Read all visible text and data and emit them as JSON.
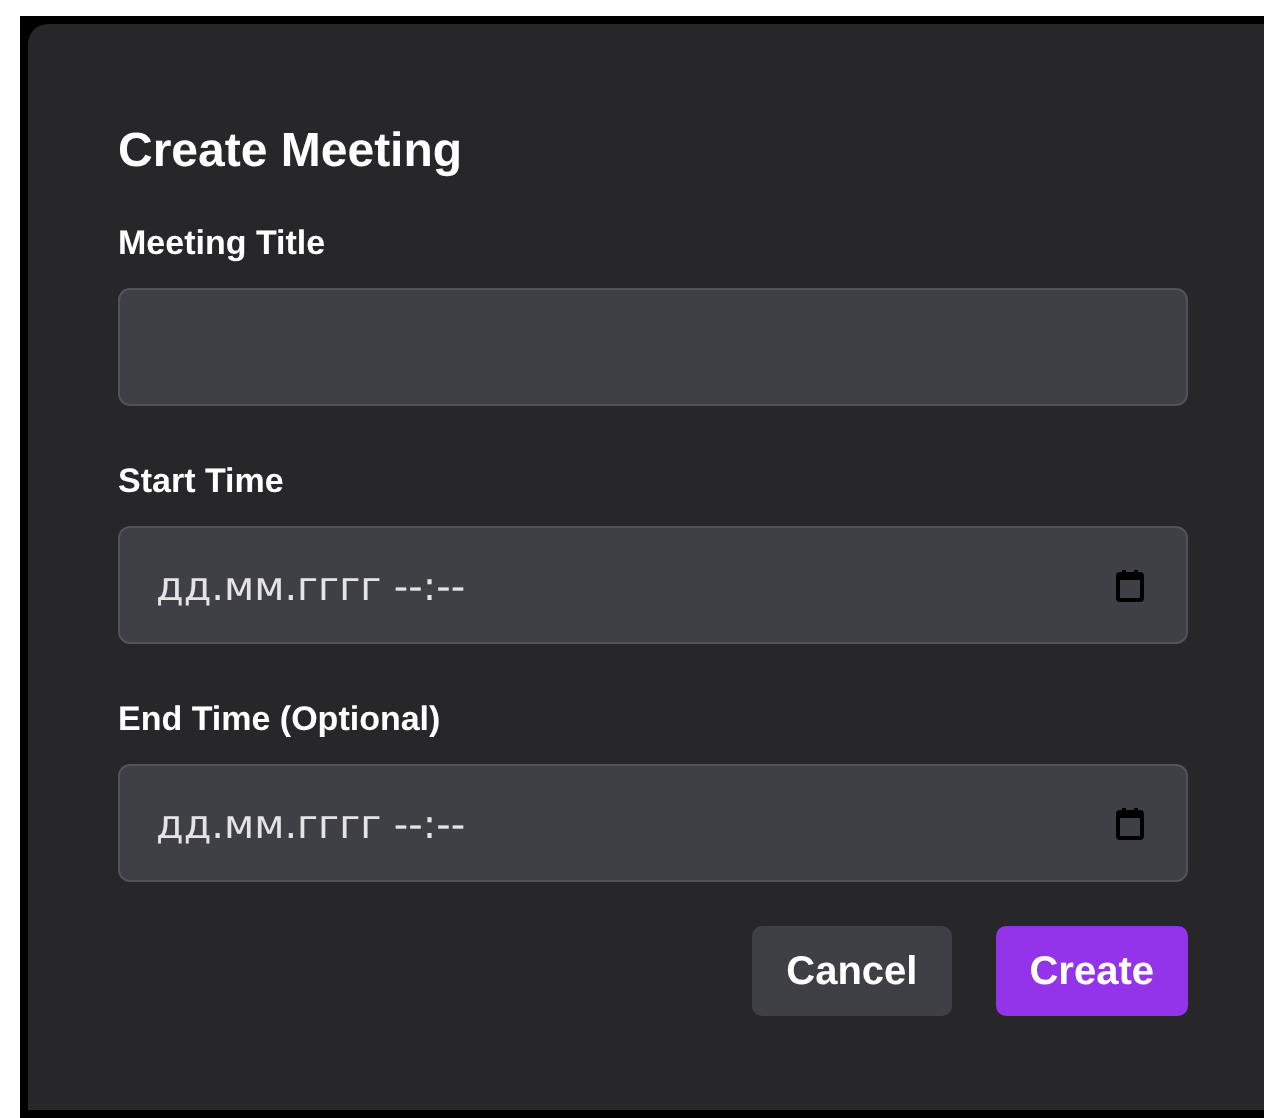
{
  "dialog": {
    "title": "Create Meeting",
    "fields": [
      {
        "kind": "text",
        "label": "Meeting Title"
      },
      {
        "kind": "datetime",
        "label": "Start Time",
        "placeholder": "дд.мм.гггг --:--"
      },
      {
        "kind": "datetime",
        "label": "End Time (Optional)",
        "placeholder": "дд.мм.гггг --:--"
      }
    ],
    "buttons": [
      {
        "kind": "secondary",
        "label": "Cancel"
      },
      {
        "kind": "primary",
        "label": "Create"
      }
    ]
  }
}
